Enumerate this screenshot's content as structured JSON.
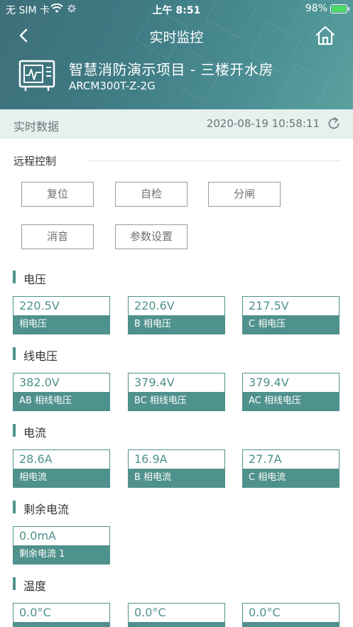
{
  "status": {
    "carrier": "无 SIM 卡",
    "time": "上午 8:51",
    "battery": "98%"
  },
  "nav": {
    "title": "实时监控"
  },
  "device": {
    "name": "智慧消防演示项目 - 三楼开水房",
    "model": "ARCM300T-Z-2G"
  },
  "realtime": {
    "label": "实时数据",
    "timestamp": "2020-08-19 10:58:11"
  },
  "remote": {
    "title": "远程控制",
    "buttons": [
      "复位",
      "自检",
      "分闸",
      "消音",
      "参数设置"
    ]
  },
  "sections": [
    {
      "title": "电压",
      "cards": [
        {
          "value": "220.5V",
          "label": "相电压"
        },
        {
          "value": "220.6V",
          "label": "B 相电压"
        },
        {
          "value": "217.5V",
          "label": "C 相电压"
        }
      ]
    },
    {
      "title": "线电压",
      "cards": [
        {
          "value": "382.0V",
          "label": "AB 相线电压"
        },
        {
          "value": "379.4V",
          "label": "BC 相线电压"
        },
        {
          "value": "379.4V",
          "label": "AC 相线电压"
        }
      ]
    },
    {
      "title": "电流",
      "cards": [
        {
          "value": "28.6A",
          "label": "相电流"
        },
        {
          "value": "16.9A",
          "label": "B 相电流"
        },
        {
          "value": "27.7A",
          "label": "C 相电流"
        }
      ]
    },
    {
      "title": "剩余电流",
      "cards": [
        {
          "value": "0.0mA",
          "label": "剩余电流 1"
        }
      ]
    },
    {
      "title": "温度",
      "cards": [
        {
          "value": "0.0°C",
          "label": ""
        },
        {
          "value": "0.0°C",
          "label": ""
        },
        {
          "value": "0.0°C",
          "label": ""
        }
      ]
    }
  ],
  "colors": {
    "accent": "#4f918c",
    "header": "#3f7a83",
    "realtime_bar": "#e5f0ef"
  },
  "icons": [
    "back-arrow-icon",
    "home-icon",
    "device-monitor-icon",
    "refresh-icon",
    "wifi-icon",
    "battery-icon"
  ]
}
